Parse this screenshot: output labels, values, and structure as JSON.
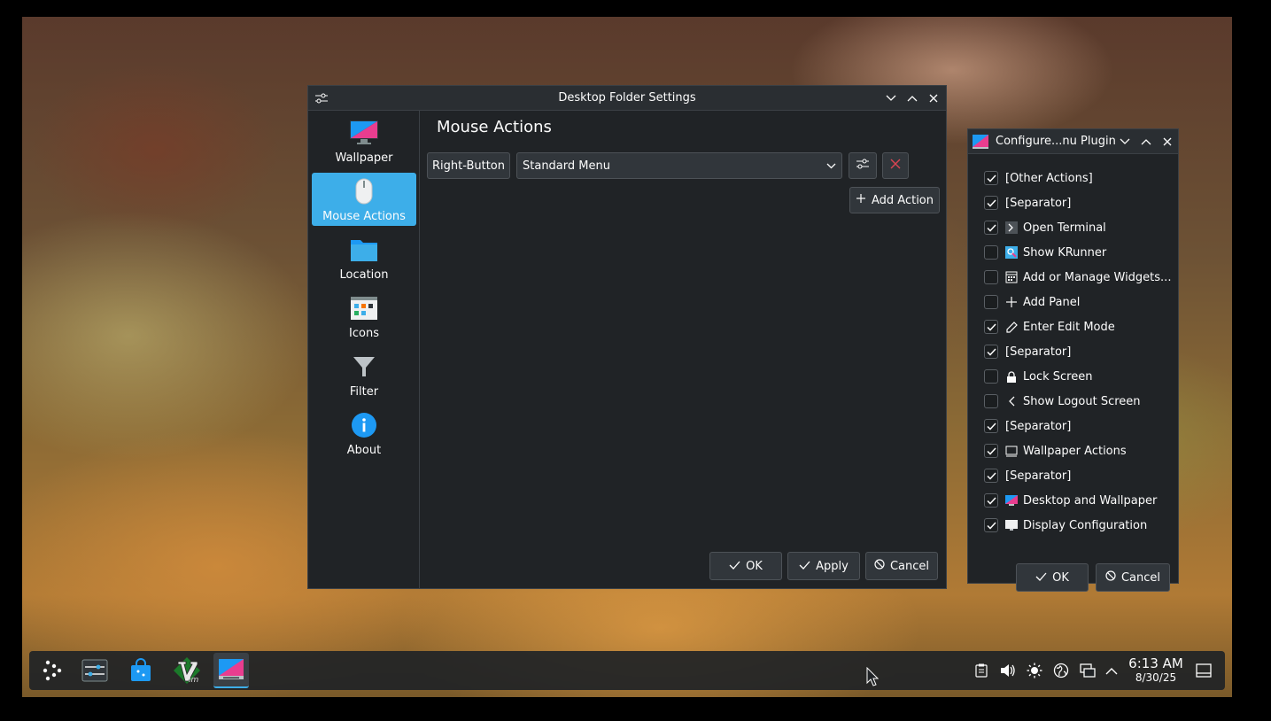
{
  "main_window": {
    "title": "Desktop Folder Settings",
    "sidebar": [
      {
        "label": "Wallpaper",
        "icon": "monitor-icon"
      },
      {
        "label": "Mouse Actions",
        "icon": "mouse-icon"
      },
      {
        "label": "Location",
        "icon": "folder-icon"
      },
      {
        "label": "Icons",
        "icon": "icons-grid-icon"
      },
      {
        "label": "Filter",
        "icon": "funnel-icon"
      },
      {
        "label": "About",
        "icon": "info-icon"
      }
    ],
    "heading": "Mouse Actions",
    "trigger_button": "Right-Button",
    "action_select": "Standard Menu",
    "add_action": "Add Action",
    "ok": "OK",
    "apply": "Apply",
    "cancel": "Cancel"
  },
  "side_window": {
    "title": "Configure...nu Plugin",
    "items": [
      {
        "label": "[Other Actions]",
        "checked": true,
        "icon": ""
      },
      {
        "label": "[Separator]",
        "checked": true,
        "icon": ""
      },
      {
        "label": "Open Terminal",
        "checked": true,
        "icon": "terminal-icon"
      },
      {
        "label": "Show KRunner",
        "checked": false,
        "icon": "krunner-icon"
      },
      {
        "label": "Add or Manage Widgets...",
        "checked": false,
        "icon": "widgets-icon"
      },
      {
        "label": "Add Panel",
        "checked": false,
        "icon": "plus-icon"
      },
      {
        "label": "Enter Edit Mode",
        "checked": true,
        "icon": "pencil-icon"
      },
      {
        "label": "[Separator]",
        "checked": true,
        "icon": ""
      },
      {
        "label": "Lock Screen",
        "checked": false,
        "icon": "lock-icon"
      },
      {
        "label": "Show Logout Screen",
        "checked": false,
        "icon": "chevron-left-icon"
      },
      {
        "label": "[Separator]",
        "checked": true,
        "icon": ""
      },
      {
        "label": "Wallpaper Actions",
        "checked": true,
        "icon": "wallpaper-icon"
      },
      {
        "label": "[Separator]",
        "checked": true,
        "icon": ""
      },
      {
        "label": "Desktop and Wallpaper",
        "checked": true,
        "icon": "desktop-wallpaper-icon"
      },
      {
        "label": "Display Configuration",
        "checked": true,
        "icon": "display-icon"
      }
    ],
    "ok": "OK",
    "cancel": "Cancel"
  },
  "taskbar": {
    "apps": [
      "application-launcher-icon",
      "system-settings-icon",
      "discover-icon",
      "vim-icon",
      "desktop-settings-icon"
    ],
    "tray": [
      "clipboard-icon",
      "volume-icon",
      "brightness-icon",
      "network-icon",
      "display-tray-icon",
      "expand-tray-icon"
    ],
    "time": "6:13 AM",
    "date": "8/30/25"
  },
  "colors": {
    "accent": "#3daee9",
    "window_bg": "#202326",
    "danger": "#da4453"
  }
}
